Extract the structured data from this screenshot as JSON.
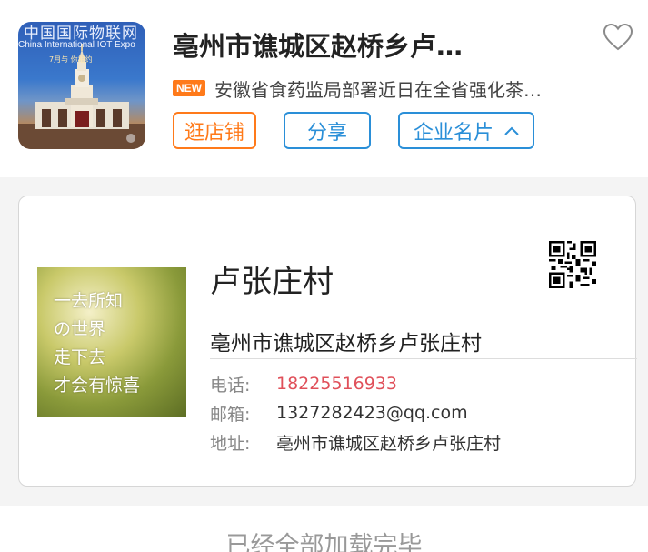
{
  "header": {
    "logo": {
      "title": "中国国际物联网",
      "subtitle": "China International IOT Expo",
      "date": "7月与 你相约"
    },
    "shop_title": "亳州市谯城区赵桥乡卢…",
    "news_badge": "NEW",
    "news_text": "安徽省食药监局部署近日在全省强化茶…",
    "buttons": {
      "shop": "逛店铺",
      "share": "分享",
      "card": "企业名片"
    }
  },
  "card": {
    "avatar_text": [
      "一去所知",
      "の世界",
      "走下去",
      "才会有惊喜"
    ],
    "name": "卢张庄村",
    "address_title": "亳州市谯城区赵桥乡卢张庄村",
    "phone_label": "电话:",
    "phone": "18225516933",
    "email_label": "邮箱:",
    "email": "1327282423@qq.com",
    "address_label": "地址:",
    "address": "亳州市谯城区赵桥乡卢张庄村"
  },
  "footer": {
    "status": "已经全部加载完毕"
  },
  "colors": {
    "accent_orange": "#ff7a1a",
    "accent_blue": "#2a8fd8",
    "phone_red": "#e0505a"
  },
  "icons": {
    "favorite": "heart-outline-icon",
    "card_toggle": "chevron-up-icon",
    "qr": "qr-code-icon"
  }
}
